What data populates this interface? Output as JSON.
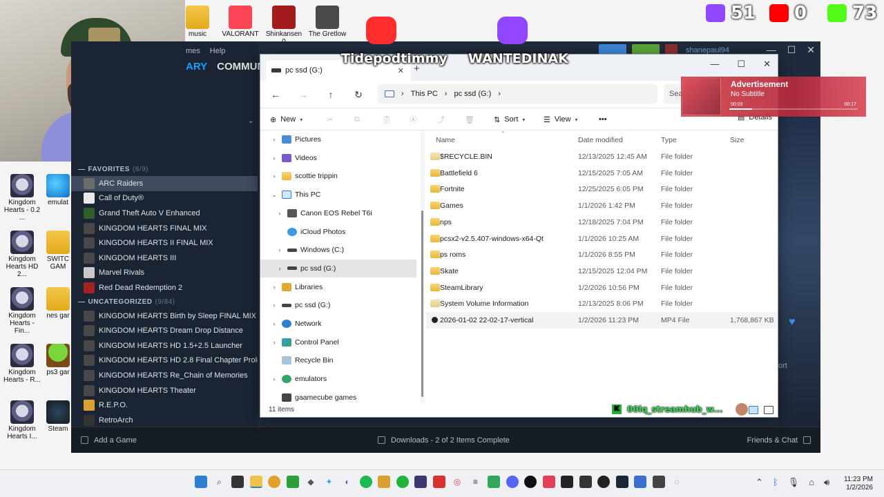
{
  "desktop": {
    "top_icons": [
      {
        "label": "music"
      },
      {
        "label": "VALORANT"
      },
      {
        "label": "Shinkansen 0"
      },
      {
        "label": "The Gretlow"
      }
    ],
    "left_icons": [
      {
        "label": "Kingdom Hearts - 0.2 ..."
      },
      {
        "label": "Kingdom Hearts HD 2..."
      },
      {
        "label": "Kingdom Hearts - Fin..."
      },
      {
        "label": "Kingdom Hearts - R..."
      },
      {
        "label": "Kingdom Hearts I..."
      }
    ],
    "second_col_icons": [
      {
        "label": "emulat"
      },
      {
        "label": "SWITC GAM"
      },
      {
        "label": "nes gar"
      },
      {
        "label": "ps3 gar"
      },
      {
        "label": "Steam"
      }
    ]
  },
  "overlay": {
    "twitch_count": "51",
    "youtube_count": "0",
    "kick_count": "73",
    "left_name": "Tidepodtimmy",
    "right_name": "WANTEDINAK",
    "streamhub_text": "00lq_streamhub_w...",
    "colors": {
      "twitch": "#9146ff",
      "youtube": "#ff0000",
      "kick": "#53fc18"
    }
  },
  "steam": {
    "menu": [
      "mes",
      "Help"
    ],
    "nav": [
      "ARY",
      "COMMUN"
    ],
    "user": "shanepaul94",
    "favorites_label": "FAVORITES",
    "favorites_count": "(8/9)",
    "favorites": [
      "ARC Raiders",
      "Call of Duty®",
      "Grand Theft Auto V Enhanced",
      "KINGDOM HEARTS FINAL MIX",
      "KINGDOM HEARTS II FINAL MIX",
      "KINGDOM HEARTS III",
      "Marvel Rivals",
      "Red Dead Redemption 2"
    ],
    "uncategorized_label": "UNCATEGORIZED",
    "uncategorized_count": "(9/84)",
    "uncategorized": [
      "KINGDOM HEARTS Birth by Sleep FINAL MIX",
      "KINGDOM HEARTS Dream Drop Distance",
      "KINGDOM HEARTS HD 1.5+2.5 Launcher",
      "KINGDOM HEARTS HD 2.8 Final Chapter Prolo",
      "KINGDOM HEARTS Re_Chain of Memories",
      "KINGDOM HEARTS Theater",
      "R.E.P.O.",
      "RetroArch"
    ],
    "add_game": "Add a Game",
    "downloads": "Downloads - 2 of 2 Items Complete",
    "friends": "Friends & Chat",
    "right_text": "ort"
  },
  "explorer": {
    "tab_title": "pc ssd (G:)",
    "breadcrumb": [
      "This PC",
      "pc ssd (G:)"
    ],
    "search_placeholder": "Sea",
    "toolbar": {
      "new": "New",
      "sort": "Sort",
      "view": "View",
      "more": "•••",
      "details": "Details"
    },
    "nav_items": [
      {
        "label": "Pictures",
        "icon": "n-pic",
        "indent": 0,
        "chev": "›"
      },
      {
        "label": "Videos",
        "icon": "n-vid",
        "indent": 0,
        "chev": "›"
      },
      {
        "label": "scottie trippin",
        "icon": "n-folder",
        "indent": 0,
        "chev": "›"
      },
      {
        "label": "This PC",
        "icon": "n-pc",
        "indent": 0,
        "chev": "⌄"
      },
      {
        "label": "Canon EOS Rebel T6i",
        "icon": "n-cam",
        "indent": 1,
        "chev": "›"
      },
      {
        "label": "iCloud Photos",
        "icon": "n-cloud",
        "indent": 1,
        "chev": ""
      },
      {
        "label": "Windows (C:)",
        "icon": "n-drive",
        "indent": 1,
        "chev": "›"
      },
      {
        "label": "pc ssd (G:)",
        "icon": "n-drive",
        "indent": 1,
        "chev": "›",
        "selected": true
      },
      {
        "label": "Libraries",
        "icon": "n-lib",
        "indent": 0,
        "chev": "›"
      },
      {
        "label": "pc ssd (G:)",
        "icon": "n-drive",
        "indent": 0,
        "chev": "›"
      },
      {
        "label": "Network",
        "icon": "n-net",
        "indent": 0,
        "chev": "›"
      },
      {
        "label": "Control Panel",
        "icon": "n-cp",
        "indent": 0,
        "chev": "›"
      },
      {
        "label": "Recycle Bin",
        "icon": "n-bin",
        "indent": 0,
        "chev": ""
      },
      {
        "label": "emulators",
        "icon": "n-emu",
        "indent": 0,
        "chev": "›"
      },
      {
        "label": "gaamecube games",
        "icon": "n-gc",
        "indent": 0,
        "chev": ""
      }
    ],
    "columns": {
      "name": "Name",
      "date": "Date modified",
      "type": "Type",
      "size": "Size"
    },
    "files": [
      {
        "name": "$RECYCLE.BIN",
        "date": "12/13/2025 12:45 AM",
        "type": "File folder",
        "size": "",
        "kind": "ghost"
      },
      {
        "name": "Battlefield 6",
        "date": "12/15/2025 7:05 AM",
        "type": "File folder",
        "size": "",
        "kind": "folder"
      },
      {
        "name": "Fortnite",
        "date": "12/25/2025 6:05 PM",
        "type": "File folder",
        "size": "",
        "kind": "folder"
      },
      {
        "name": "Games",
        "date": "1/1/2026 1:42 PM",
        "type": "File folder",
        "size": "",
        "kind": "folder"
      },
      {
        "name": "nps",
        "date": "12/18/2025 7:04 PM",
        "type": "File folder",
        "size": "",
        "kind": "folder"
      },
      {
        "name": "pcsx2-v2.5.407-windows-x64-Qt",
        "date": "1/1/2026 10:25 AM",
        "type": "File folder",
        "size": "",
        "kind": "folder"
      },
      {
        "name": "ps roms",
        "date": "1/1/2026 8:55 PM",
        "type": "File folder",
        "size": "",
        "kind": "folder"
      },
      {
        "name": "Skate",
        "date": "12/15/2025 12:04 PM",
        "type": "File folder",
        "size": "",
        "kind": "folder"
      },
      {
        "name": "SteamLibrary",
        "date": "1/2/2026 10:56 PM",
        "type": "File folder",
        "size": "",
        "kind": "folder"
      },
      {
        "name": "System Volume Information",
        "date": "12/13/2025 8:06 PM",
        "type": "File folder",
        "size": "",
        "kind": "ghost"
      },
      {
        "name": "2026-01-02 22-02-17-vertical",
        "date": "1/2/2026 11:23 PM",
        "type": "MP4 File",
        "size": "1,768,867 KB",
        "kind": "mp4",
        "selected": true
      }
    ],
    "status": "11 items"
  },
  "ad": {
    "title": "Advertisement",
    "subtitle": "No Subtitle",
    "time_current": "00:03",
    "time_total": "00:17",
    "progress": 0.18
  },
  "taskbar": {
    "time": "11:23 PM",
    "date": "1/2/2026"
  }
}
